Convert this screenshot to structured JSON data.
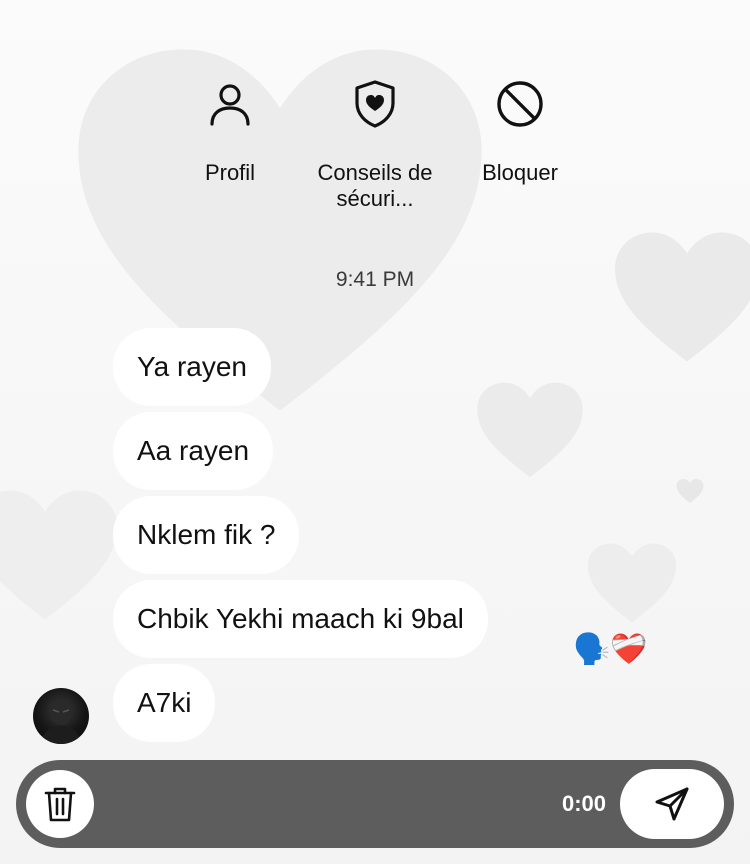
{
  "header_actions": [
    {
      "label": "Profil",
      "icon": "person-icon"
    },
    {
      "label": "Conseils de sécuri...",
      "icon": "shield-heart-icon"
    },
    {
      "label": "Bloquer",
      "icon": "block-icon"
    }
  ],
  "timestamp": "9:41 PM",
  "messages": [
    {
      "text": "Ya rayen"
    },
    {
      "text": "Aa rayen"
    },
    {
      "text": "Nklem fik ?"
    },
    {
      "text": "Chbik Yekhi maach ki 9bal"
    },
    {
      "text": "A7ki"
    }
  ],
  "reaction": {
    "emoji": "🗣️❤️‍🩹"
  },
  "composer": {
    "timer": "0:00",
    "delete_icon": "trash-icon",
    "send_icon": "send-icon"
  },
  "colors": {
    "composer_bg": "#5d5d5d",
    "bubble_bg": "#ffffff",
    "text": "#111111"
  }
}
